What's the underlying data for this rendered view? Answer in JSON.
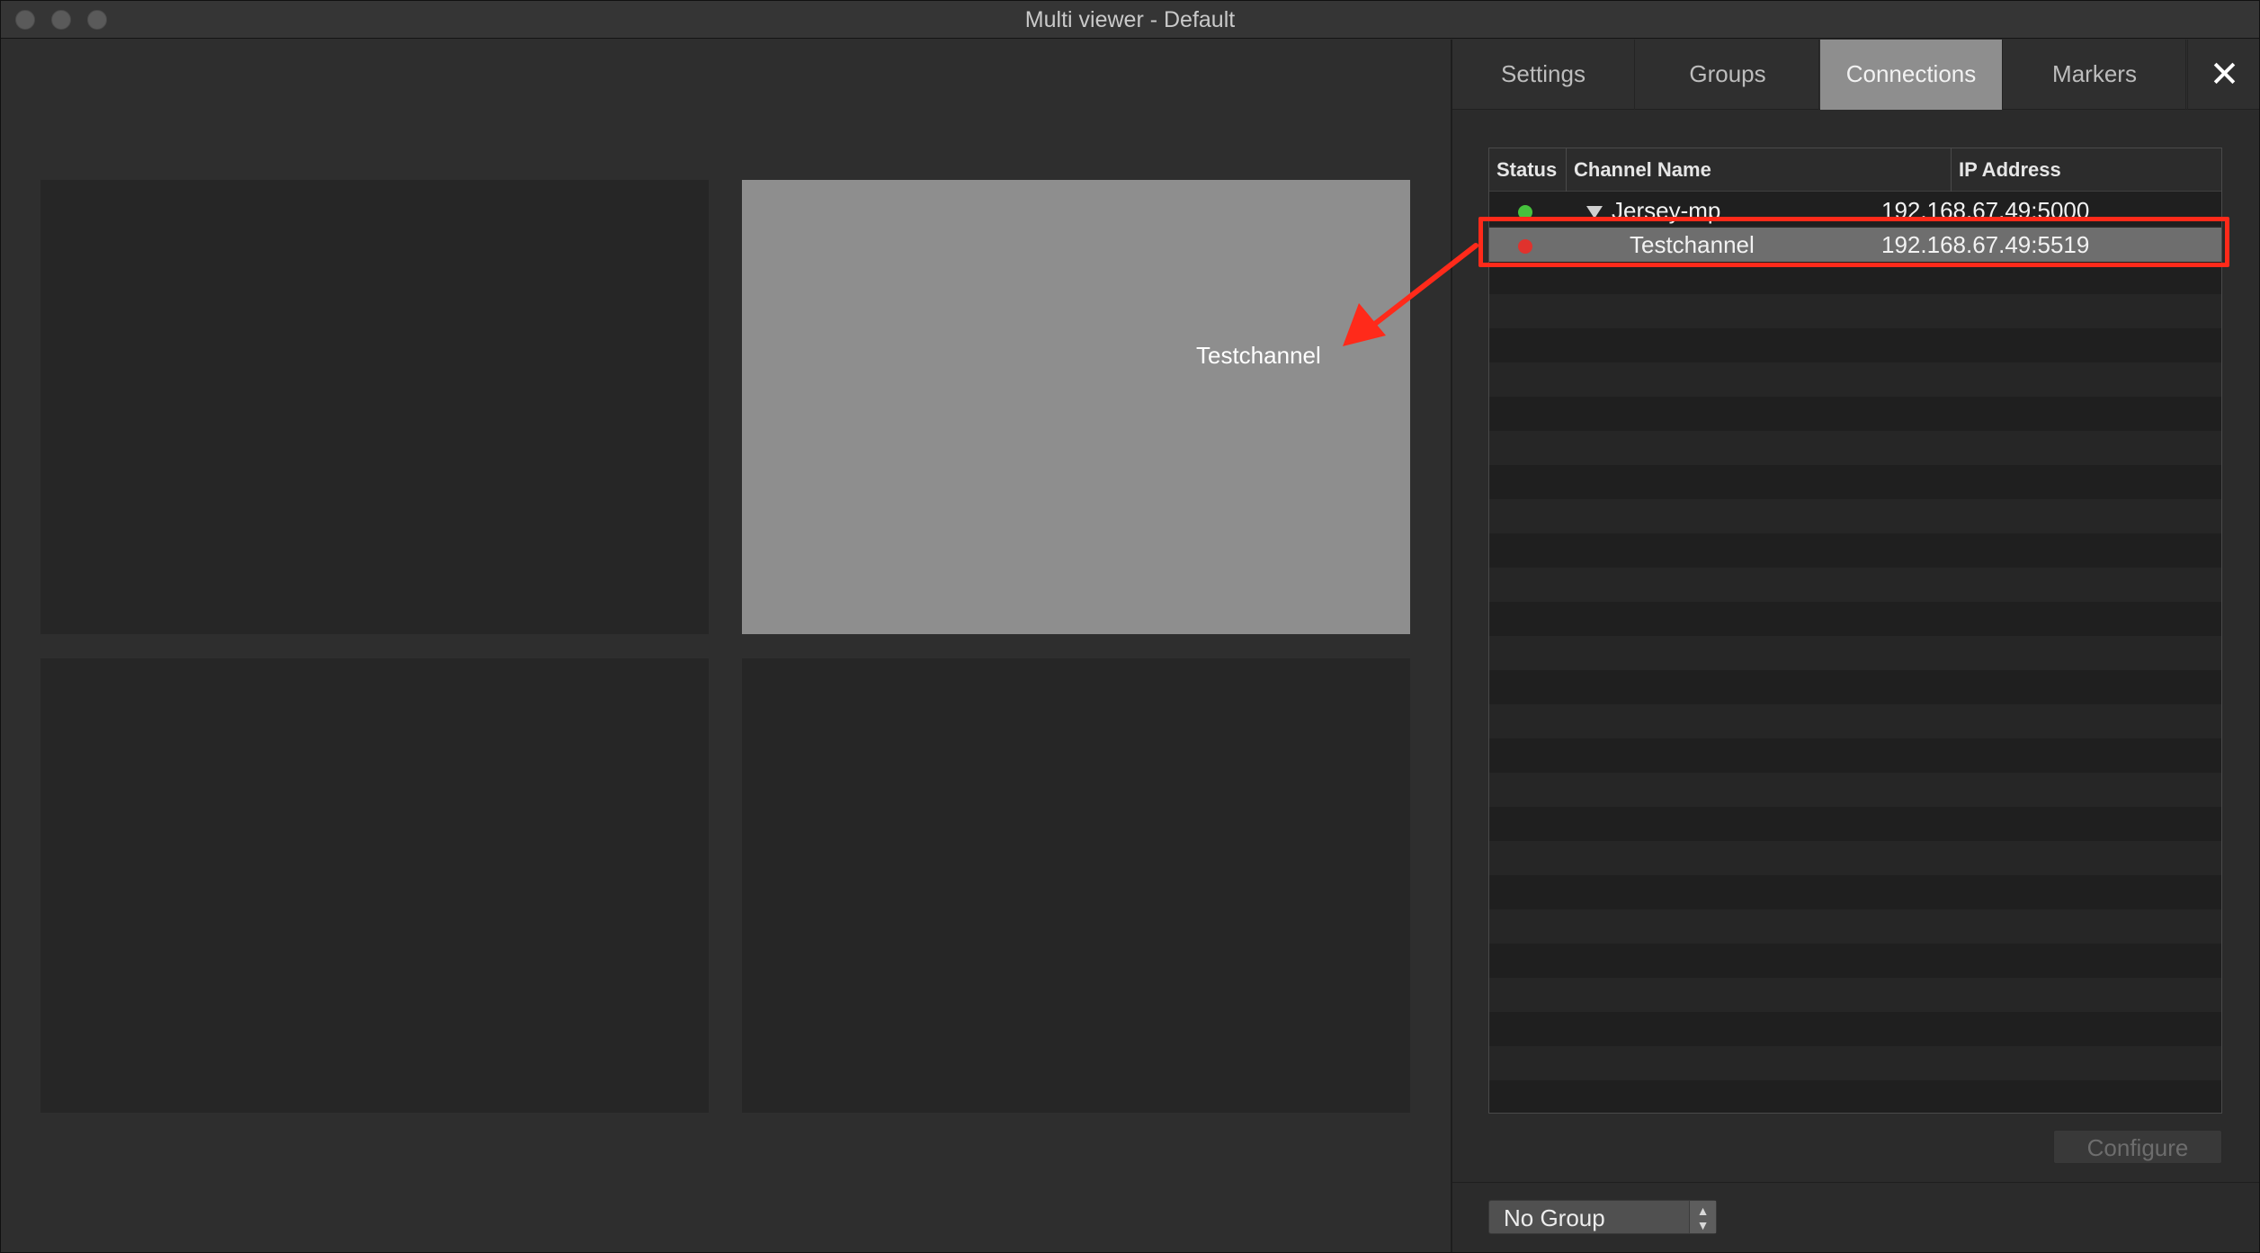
{
  "window": {
    "title": "Multi viewer - Default"
  },
  "viewer": {
    "tiles": [
      {
        "label": ""
      },
      {
        "label": "Testchannel"
      },
      {
        "label": ""
      },
      {
        "label": ""
      }
    ]
  },
  "panel": {
    "tabs": [
      {
        "label": "Settings",
        "active": false
      },
      {
        "label": "Groups",
        "active": false
      },
      {
        "label": "Connections",
        "active": true
      },
      {
        "label": "Markers",
        "active": false
      }
    ],
    "close_label": "✕",
    "table": {
      "columns": [
        "Status",
        "Channel Name",
        "IP Address"
      ],
      "rows": [
        {
          "status": "green",
          "name": "Jersey-mp",
          "ip": "192.168.67.49:5000",
          "expanded": true
        },
        {
          "status": "red",
          "name": "Testchannel",
          "ip": "192.168.67.49:5519",
          "selected": true
        }
      ]
    },
    "configure_label": "Configure",
    "group_select": {
      "value": "No Group"
    }
  },
  "colors": {
    "status_online": "#46c23d",
    "status_offline": "#e0322d",
    "annotation": "#ff2a1a",
    "active_tab": "#8e8e8e"
  }
}
